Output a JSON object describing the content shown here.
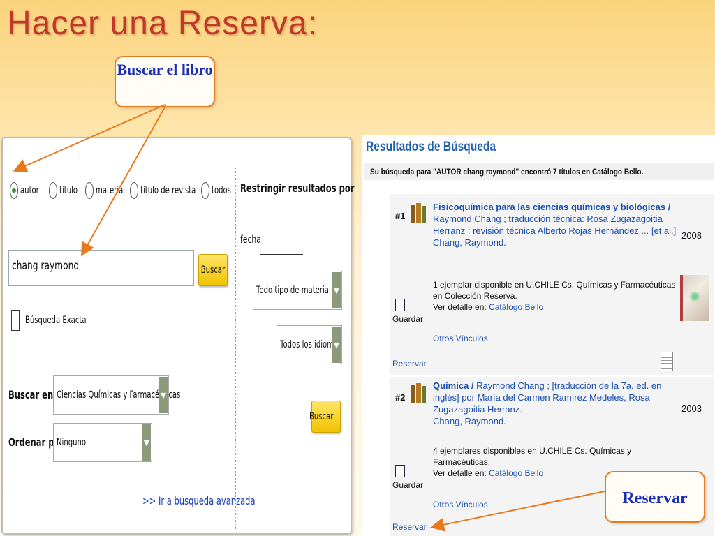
{
  "slide": {
    "title": "Hacer una Reserva:",
    "callout_search": "Buscar el libro",
    "callout_reserve": "Reservar"
  },
  "search_panel": {
    "radios": [
      {
        "label": "autor",
        "selected": true
      },
      {
        "label": "título",
        "selected": false
      },
      {
        "label": "materia",
        "selected": false
      },
      {
        "label": "título de revista",
        "selected": false
      },
      {
        "label": "todos",
        "selected": false
      }
    ],
    "query_value": "chang raymond",
    "search_button": "Buscar",
    "exact_search_label": "Búsqueda Exacta",
    "restrict_label": "Restringir resultados por",
    "date_label": "fecha",
    "material_select": "Todo tipo de material",
    "language_select": "Todos los idiomas",
    "search_in_label": "Buscar en",
    "search_in_value": "Ciencias Químicas y Farmacéuticas",
    "sort_label": "Ordenar por",
    "sort_value": "Ninguno",
    "search_button_2": "Buscar",
    "advanced_link": ">> Ir a búsqueda avanzada"
  },
  "results": {
    "title": "Resultados de Búsqueda",
    "summary": "Su búsqueda para \"AUTOR chang raymond\" encontró 7 títulos en Catálogo Bello.",
    "items": [
      {
        "num": "#1",
        "title_bold": "Fisicoquímica para las ciencias químicas y biológicas /",
        "title_rest": "Raymond Chang ; traducción técnica: Rosa Zugazagoitia Herranz ; revisión técnica Alberto Rojas Hernández ... [et al.]",
        "author": "Chang, Raymond.",
        "year": "2008",
        "availability": "1 ejemplar disponible en U.CHILE Cs. Químicas y Farmacéuticas en Colección Reserva.",
        "detail_label": "Ver detalle en:",
        "detail_link": "Catálogo Bello",
        "other_links": "Otros Vínculos",
        "save_label": "Guardar",
        "reserve_link": "Reservar"
      },
      {
        "num": "#2",
        "title_bold": "Química /",
        "title_rest": "Raymond Chang ; [traducción de la 7a. ed. en inglés] por María del Carmen Ramírez Medeles, Rosa Zugazagoitia Herranz.",
        "author": "Chang, Raymond.",
        "year": "2003",
        "availability": "4 ejemplares disponibles en U.CHILE Cs. Químicas y Farmacéuticas.",
        "detail_label": "Ver detalle en:",
        "detail_link": "Catálogo Bello",
        "other_links": "Otros Vínculos",
        "save_label": "Guardar",
        "reserve_link": "Reservar"
      }
    ]
  },
  "colors": {
    "title_red": "#c0392b",
    "callout_blue": "#1a2fb4",
    "arrow_orange": "#e87a1e",
    "link_blue": "#1a4fb0",
    "button_yellow": "#f1c200"
  }
}
